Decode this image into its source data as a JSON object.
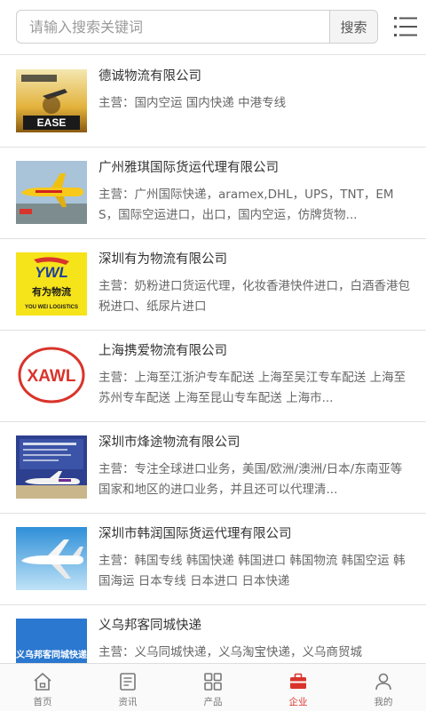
{
  "search": {
    "placeholder": "请输入搜索关键词",
    "button_label": "搜索"
  },
  "companies": [
    {
      "name": "德诚物流有限公司",
      "desc": "主营：国内空运 国内快递 中港专线",
      "thumb_text": [
        "EASE"
      ]
    },
    {
      "name": "广州雅琪国际货运代理有限公司",
      "desc": "主营：广州国际快递，aramex,DHL，UPS，TNT，EMS，国际空运进口，出口，国内空运，仿牌货物..."
    },
    {
      "name": "深圳有为物流有限公司",
      "desc": "主营：奶粉进口货运代理，化妆香港快件进口，白酒香港包税进口、纸尿片进口",
      "thumb_text": [
        "YWL",
        "有为物流",
        "YOU WEI LOGISTICS"
      ]
    },
    {
      "name": "上海携爱物流有限公司",
      "desc": "主营：上海至江浙沪专车配送 上海至吴江专车配送 上海至苏州专车配送 上海至昆山专车配送 上海市...",
      "thumb_text": [
        "XAWL"
      ]
    },
    {
      "name": "深圳市烽途物流有限公司",
      "desc": "主营：专注全球进口业务，美国/欧洲/澳洲/日本/东南亚等国家和地区的进口业务，并且还可以代理清..."
    },
    {
      "name": "深圳市韩润国际货运代理有限公司",
      "desc": "主营：韩国专线 韩国快递 韩国进口 韩国物流 韩国空运 韩国海运 日本专线 日本进口 日本快递"
    },
    {
      "name": "义乌邦客同城快递",
      "desc": "主营：义乌同城快递，义乌淘宝快递，义乌商贸城",
      "thumb_text": [
        "义乌邦客同城快递"
      ]
    }
  ],
  "nav": [
    {
      "label": "首页",
      "icon": "home-icon",
      "active": false
    },
    {
      "label": "资讯",
      "icon": "news-icon",
      "active": false
    },
    {
      "label": "产品",
      "icon": "grid-icon",
      "active": false
    },
    {
      "label": "企业",
      "icon": "company-icon",
      "active": true
    },
    {
      "label": "我的",
      "icon": "user-icon",
      "active": false
    }
  ],
  "colors": {
    "accent": "#d9342b",
    "nav_inactive": "#777777",
    "divider": "#e1e1e1"
  }
}
